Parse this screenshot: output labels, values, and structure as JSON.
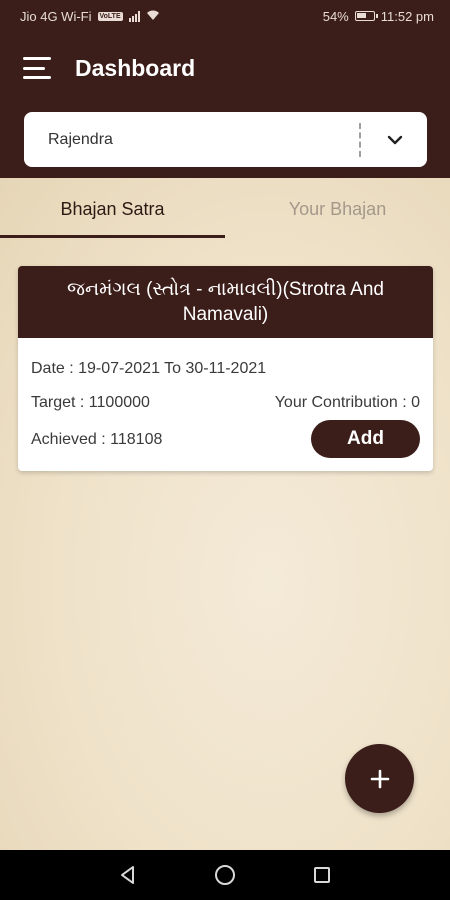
{
  "status_bar": {
    "carrier": "Jio 4G Wi-Fi",
    "volte": "VoLTE",
    "battery": "54%",
    "time": "11:52 pm"
  },
  "app_bar": {
    "title": "Dashboard",
    "menu_icon": "hamburger-icon"
  },
  "user_select": {
    "value": "Rajendra",
    "icon": "chevron-down-icon"
  },
  "tabs": [
    {
      "label": "Bhajan Satra",
      "active": true
    },
    {
      "label": "Your Bhajan",
      "active": false
    }
  ],
  "card": {
    "title": "જનમંગલ (સ્તોત્ર - નામાવલી)(Strotra And Namavali)",
    "date": "Date : 19-07-2021 To 30-11-2021",
    "target": "Target : 1100000",
    "contribution": "Your Contribution : 0",
    "achieved": "Achieved : 118108",
    "add_label": "Add"
  },
  "fab": {
    "icon": "plus-icon"
  },
  "nav": {
    "back_icon": "back-triangle-icon",
    "home_icon": "home-circle-icon",
    "recents_icon": "recents-square-icon"
  },
  "colors": {
    "primary": "#3b1d19",
    "background": "#efe3cd",
    "tab_inactive": "#a5988a"
  }
}
